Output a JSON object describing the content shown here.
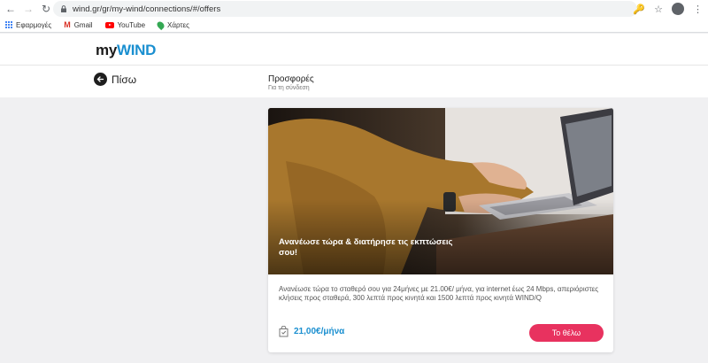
{
  "browser": {
    "url": "wind.gr/gr/my-wind/connections/#/offers",
    "bookmarks": [
      {
        "label": "Εφαρμογές",
        "icon": "apps-grid-icon"
      },
      {
        "label": "Gmail",
        "icon": "gmail-icon"
      },
      {
        "label": "YouTube",
        "icon": "youtube-icon"
      },
      {
        "label": "Χάρτες",
        "icon": "maps-icon"
      }
    ]
  },
  "header": {
    "logo_my": "my",
    "logo_wind": "WIND"
  },
  "subheader": {
    "back_label": "Πίσω",
    "title": "Προσφορές",
    "subtitle": "Για τη σύνδεση"
  },
  "offer": {
    "image_caption": "Ανανέωσε τώρα & διατήρησε τις εκπτώσεις σου!",
    "description": "Ανανέωσε τώρα το σταθερό σου για 24μήνες με 21.00€/ μήνα, για internet έως 24 Mbps, απεριόριστες κλήσεις προς σταθερά, 300 λεπτά προς κινητά και 1500 λεπτά προς κινητά WIND/Q",
    "price": "21,00€/μήνα",
    "cta_label": "Το θέλω"
  },
  "colors": {
    "brand_blue": "#1a8fd0",
    "cta_pink": "#e8325f"
  }
}
